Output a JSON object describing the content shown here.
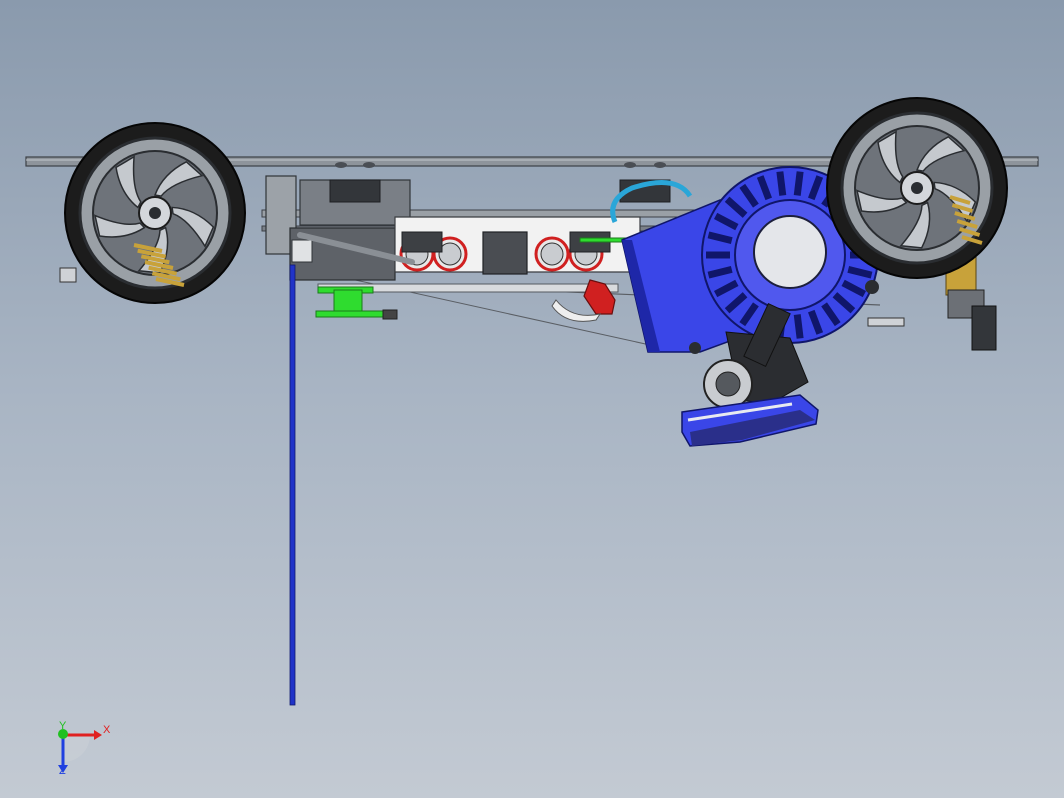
{
  "triad": {
    "x_label": "X",
    "y_label": "Y",
    "z_label": "Z",
    "x_color": "#e02020",
    "y_color": "#20c020",
    "z_color": "#2040e0"
  },
  "colors": {
    "engine_blue": "#3a46e8",
    "engine_blue_dark": "#1e27a8",
    "frame_gray": "#8e949b",
    "tire_black": "#1c1c1c",
    "rim_gray": "#9aa0a6",
    "spring_gold": "#c8a23a",
    "accent_red": "#d02020",
    "accent_green": "#2fdc2f",
    "pipe_white": "#f2f2f2",
    "hose_cyan": "#2aa6d8"
  },
  "icons": {
    "triad": "coordinate-triad-icon"
  }
}
